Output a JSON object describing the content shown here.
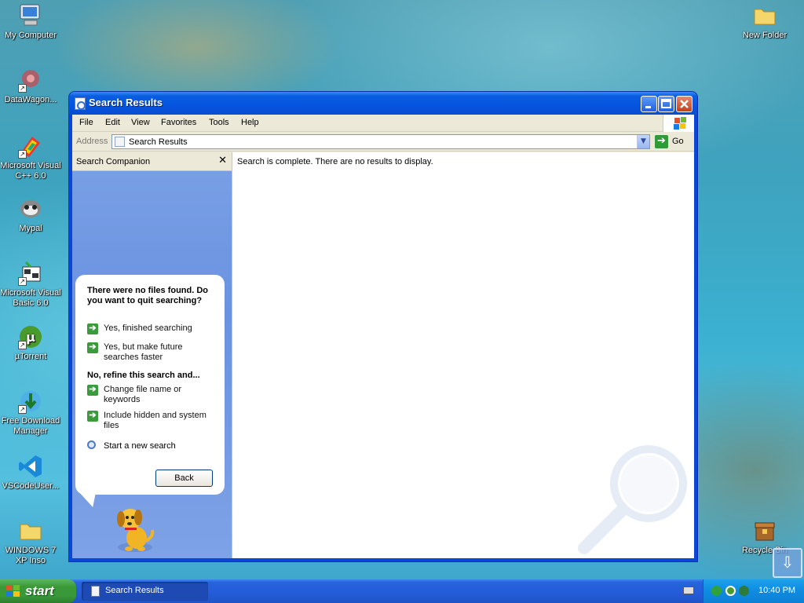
{
  "desktop": {
    "icons_left": [
      {
        "label": "My Computer",
        "icon": "computer-icon"
      },
      {
        "label": "DataWagon...",
        "icon": "datawagon-icon"
      },
      {
        "label": "Microsoft Visual C++ 6.0",
        "icon": "visual-cpp-icon"
      },
      {
        "label": "Mypal",
        "icon": "mypal-icon"
      },
      {
        "label": "Microsoft Visual Basic 6.0",
        "icon": "visual-basic-icon"
      },
      {
        "label": "µTorrent",
        "icon": "utorrent-icon"
      },
      {
        "label": "Free Download Manager",
        "icon": "free-download-manager-icon"
      },
      {
        "label": "VSCodeUser...",
        "icon": "vscode-icon"
      },
      {
        "label": "WINDOWS 7 XP Inso",
        "icon": "folder-icon"
      }
    ],
    "icons_right": [
      {
        "label": "New Folder",
        "icon": "folder-icon"
      },
      {
        "label": "Recycle Bin",
        "icon": "recycle-bin-icon"
      }
    ]
  },
  "window": {
    "title": "Search Results",
    "menu": [
      "File",
      "Edit",
      "View",
      "Favorites",
      "Tools",
      "Help"
    ],
    "address": {
      "label": "Address",
      "value": "Search Results",
      "go_label": "Go"
    },
    "companion": {
      "title": "Search Companion",
      "question": "There were no files found. Do you want to quit searching?",
      "quit_options": [
        "Yes, finished searching",
        "Yes, but make future searches faster"
      ],
      "refine_label": "No, refine this search and...",
      "refine_options": [
        "Change file name or keywords",
        "Include hidden and system files"
      ],
      "new_search": "Start a new search",
      "back_button": "Back"
    },
    "results_message": "Search is complete. There are no results to display."
  },
  "taskbar": {
    "start_label": "start",
    "task_label": "Search Results",
    "clock": "10:40 PM"
  },
  "colors": {
    "title_bar": "#0a5ee0",
    "companion_pane": "#7aa1e6",
    "start_button": "#3a9a38",
    "taskbar": "#245edb",
    "tray": "#0f8be0"
  }
}
